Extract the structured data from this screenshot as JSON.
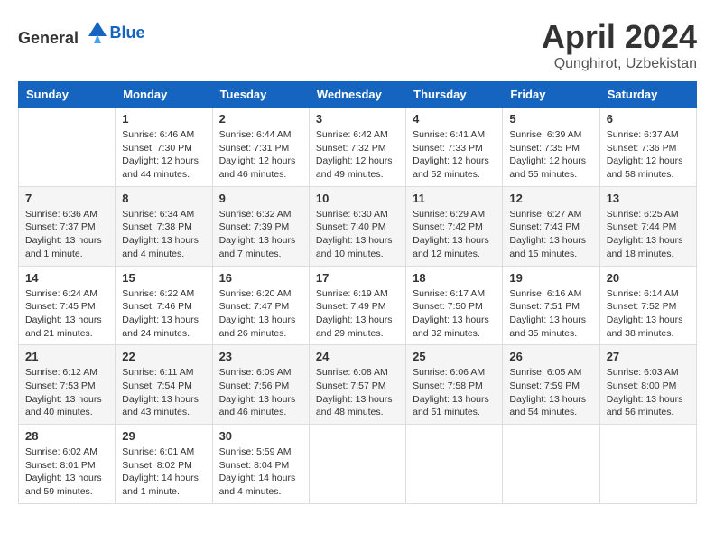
{
  "header": {
    "logo_general": "General",
    "logo_blue": "Blue",
    "month": "April 2024",
    "location": "Qunghirot, Uzbekistan"
  },
  "weekdays": [
    "Sunday",
    "Monday",
    "Tuesday",
    "Wednesday",
    "Thursday",
    "Friday",
    "Saturday"
  ],
  "weeks": [
    [
      {
        "day": "",
        "sunrise": "",
        "sunset": "",
        "daylight": ""
      },
      {
        "day": "1",
        "sunrise": "Sunrise: 6:46 AM",
        "sunset": "Sunset: 7:30 PM",
        "daylight": "Daylight: 12 hours and 44 minutes."
      },
      {
        "day": "2",
        "sunrise": "Sunrise: 6:44 AM",
        "sunset": "Sunset: 7:31 PM",
        "daylight": "Daylight: 12 hours and 46 minutes."
      },
      {
        "day": "3",
        "sunrise": "Sunrise: 6:42 AM",
        "sunset": "Sunset: 7:32 PM",
        "daylight": "Daylight: 12 hours and 49 minutes."
      },
      {
        "day": "4",
        "sunrise": "Sunrise: 6:41 AM",
        "sunset": "Sunset: 7:33 PM",
        "daylight": "Daylight: 12 hours and 52 minutes."
      },
      {
        "day": "5",
        "sunrise": "Sunrise: 6:39 AM",
        "sunset": "Sunset: 7:35 PM",
        "daylight": "Daylight: 12 hours and 55 minutes."
      },
      {
        "day": "6",
        "sunrise": "Sunrise: 6:37 AM",
        "sunset": "Sunset: 7:36 PM",
        "daylight": "Daylight: 12 hours and 58 minutes."
      }
    ],
    [
      {
        "day": "7",
        "sunrise": "Sunrise: 6:36 AM",
        "sunset": "Sunset: 7:37 PM",
        "daylight": "Daylight: 13 hours and 1 minute."
      },
      {
        "day": "8",
        "sunrise": "Sunrise: 6:34 AM",
        "sunset": "Sunset: 7:38 PM",
        "daylight": "Daylight: 13 hours and 4 minutes."
      },
      {
        "day": "9",
        "sunrise": "Sunrise: 6:32 AM",
        "sunset": "Sunset: 7:39 PM",
        "daylight": "Daylight: 13 hours and 7 minutes."
      },
      {
        "day": "10",
        "sunrise": "Sunrise: 6:30 AM",
        "sunset": "Sunset: 7:40 PM",
        "daylight": "Daylight: 13 hours and 10 minutes."
      },
      {
        "day": "11",
        "sunrise": "Sunrise: 6:29 AM",
        "sunset": "Sunset: 7:42 PM",
        "daylight": "Daylight: 13 hours and 12 minutes."
      },
      {
        "day": "12",
        "sunrise": "Sunrise: 6:27 AM",
        "sunset": "Sunset: 7:43 PM",
        "daylight": "Daylight: 13 hours and 15 minutes."
      },
      {
        "day": "13",
        "sunrise": "Sunrise: 6:25 AM",
        "sunset": "Sunset: 7:44 PM",
        "daylight": "Daylight: 13 hours and 18 minutes."
      }
    ],
    [
      {
        "day": "14",
        "sunrise": "Sunrise: 6:24 AM",
        "sunset": "Sunset: 7:45 PM",
        "daylight": "Daylight: 13 hours and 21 minutes."
      },
      {
        "day": "15",
        "sunrise": "Sunrise: 6:22 AM",
        "sunset": "Sunset: 7:46 PM",
        "daylight": "Daylight: 13 hours and 24 minutes."
      },
      {
        "day": "16",
        "sunrise": "Sunrise: 6:20 AM",
        "sunset": "Sunset: 7:47 PM",
        "daylight": "Daylight: 13 hours and 26 minutes."
      },
      {
        "day": "17",
        "sunrise": "Sunrise: 6:19 AM",
        "sunset": "Sunset: 7:49 PM",
        "daylight": "Daylight: 13 hours and 29 minutes."
      },
      {
        "day": "18",
        "sunrise": "Sunrise: 6:17 AM",
        "sunset": "Sunset: 7:50 PM",
        "daylight": "Daylight: 13 hours and 32 minutes."
      },
      {
        "day": "19",
        "sunrise": "Sunrise: 6:16 AM",
        "sunset": "Sunset: 7:51 PM",
        "daylight": "Daylight: 13 hours and 35 minutes."
      },
      {
        "day": "20",
        "sunrise": "Sunrise: 6:14 AM",
        "sunset": "Sunset: 7:52 PM",
        "daylight": "Daylight: 13 hours and 38 minutes."
      }
    ],
    [
      {
        "day": "21",
        "sunrise": "Sunrise: 6:12 AM",
        "sunset": "Sunset: 7:53 PM",
        "daylight": "Daylight: 13 hours and 40 minutes."
      },
      {
        "day": "22",
        "sunrise": "Sunrise: 6:11 AM",
        "sunset": "Sunset: 7:54 PM",
        "daylight": "Daylight: 13 hours and 43 minutes."
      },
      {
        "day": "23",
        "sunrise": "Sunrise: 6:09 AM",
        "sunset": "Sunset: 7:56 PM",
        "daylight": "Daylight: 13 hours and 46 minutes."
      },
      {
        "day": "24",
        "sunrise": "Sunrise: 6:08 AM",
        "sunset": "Sunset: 7:57 PM",
        "daylight": "Daylight: 13 hours and 48 minutes."
      },
      {
        "day": "25",
        "sunrise": "Sunrise: 6:06 AM",
        "sunset": "Sunset: 7:58 PM",
        "daylight": "Daylight: 13 hours and 51 minutes."
      },
      {
        "day": "26",
        "sunrise": "Sunrise: 6:05 AM",
        "sunset": "Sunset: 7:59 PM",
        "daylight": "Daylight: 13 hours and 54 minutes."
      },
      {
        "day": "27",
        "sunrise": "Sunrise: 6:03 AM",
        "sunset": "Sunset: 8:00 PM",
        "daylight": "Daylight: 13 hours and 56 minutes."
      }
    ],
    [
      {
        "day": "28",
        "sunrise": "Sunrise: 6:02 AM",
        "sunset": "Sunset: 8:01 PM",
        "daylight": "Daylight: 13 hours and 59 minutes."
      },
      {
        "day": "29",
        "sunrise": "Sunrise: 6:01 AM",
        "sunset": "Sunset: 8:02 PM",
        "daylight": "Daylight: 14 hours and 1 minute."
      },
      {
        "day": "30",
        "sunrise": "Sunrise: 5:59 AM",
        "sunset": "Sunset: 8:04 PM",
        "daylight": "Daylight: 14 hours and 4 minutes."
      },
      {
        "day": "",
        "sunrise": "",
        "sunset": "",
        "daylight": ""
      },
      {
        "day": "",
        "sunrise": "",
        "sunset": "",
        "daylight": ""
      },
      {
        "day": "",
        "sunrise": "",
        "sunset": "",
        "daylight": ""
      },
      {
        "day": "",
        "sunrise": "",
        "sunset": "",
        "daylight": ""
      }
    ]
  ]
}
